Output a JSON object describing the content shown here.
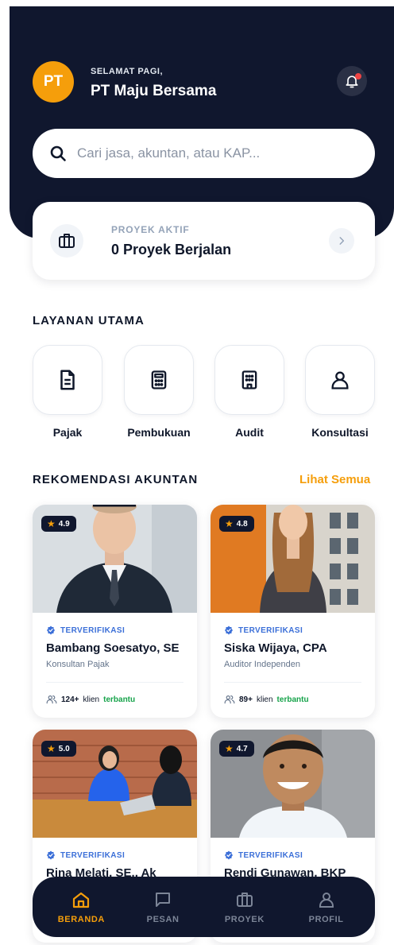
{
  "header": {
    "avatar_initials": "PT",
    "greeting": "SELAMAT PAGI,",
    "company_name": "PT Maju Bersama",
    "notification_icon": "bell-icon"
  },
  "search": {
    "placeholder": "Cari jasa, akuntan, atau KAP...",
    "value": ""
  },
  "active_project": {
    "label": "PROYEK AKTIF",
    "value": "0 Proyek Berjalan"
  },
  "services": {
    "title": "LAYANAN UTAMA",
    "items": [
      {
        "label": "Pajak",
        "icon": "document-icon"
      },
      {
        "label": "Pembukuan",
        "icon": "calculator-icon"
      },
      {
        "label": "Audit",
        "icon": "building-icon"
      },
      {
        "label": "Konsultasi",
        "icon": "user-icon"
      }
    ]
  },
  "recommendations": {
    "title": "REKOMENDASI AKUNTAN",
    "see_all": "Lihat Semua",
    "items": [
      {
        "rating": "4.9",
        "verified": "TERVERIFIKASI",
        "name": "Bambang Soesatyo, SE",
        "role": "Konsultan Pajak",
        "clients": "124+",
        "clients_text": "klien",
        "clients_status": "terbantu"
      },
      {
        "rating": "4.8",
        "verified": "TERVERIFIKASI",
        "name": "Siska Wijaya, CPA",
        "role": "Auditor Independen",
        "clients": "89+",
        "clients_text": "klien",
        "clients_status": "terbantu"
      },
      {
        "rating": "5.0",
        "verified": "TERVERIFIKASI",
        "name": "Rina Melati, SE., Ak"
      },
      {
        "rating": "4.7",
        "verified": "TERVERIFIKASI",
        "name": "Rendi Gunawan, BKP"
      }
    ]
  },
  "bottom_nav": {
    "items": [
      {
        "label": "BERANDA",
        "icon": "home-icon",
        "active": true
      },
      {
        "label": "PESAN",
        "icon": "chat-icon"
      },
      {
        "label": "PROYEK",
        "icon": "briefcase-icon"
      },
      {
        "label": "PROFIL",
        "icon": "user-icon"
      }
    ]
  },
  "colors": {
    "navy": "#10172e",
    "accent": "#f59e0b",
    "verified_blue": "#3b6fd8",
    "success_green": "#16a34a"
  }
}
